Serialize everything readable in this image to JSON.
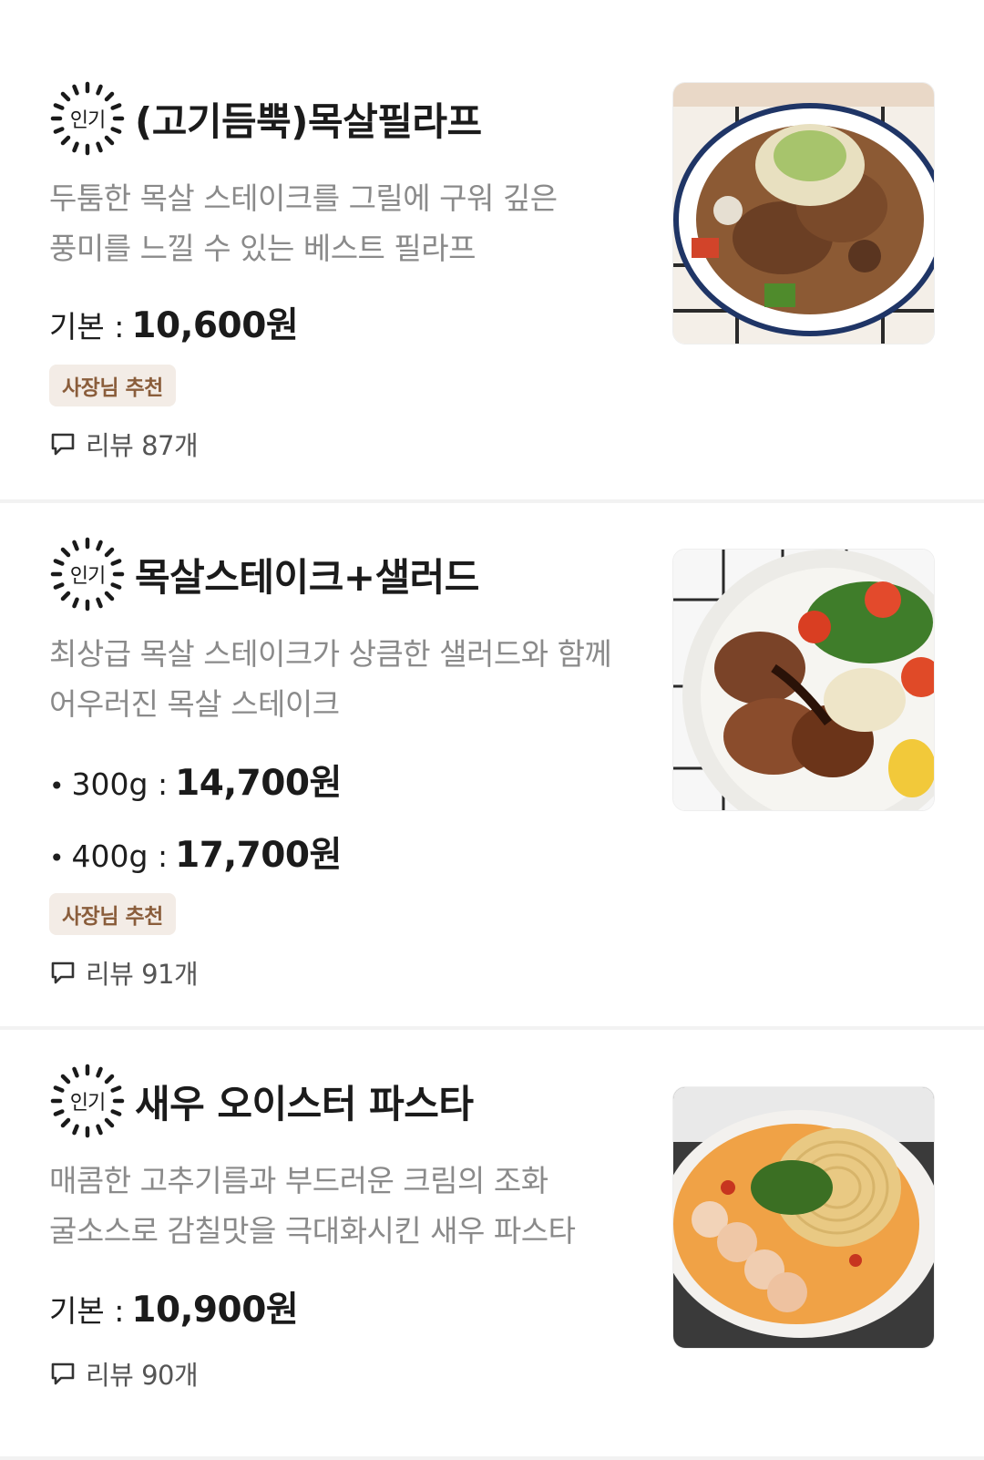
{
  "items": [
    {
      "badge": "인기",
      "title": "(고기듬뿍)목살필라프",
      "desc": [
        "두툼한 목살 스테이크를 그릴에 구워 깊은",
        "풍미를 느낄 수 있는 베스트 필라프"
      ],
      "price_label": "기본 :",
      "price_value": "10,600원",
      "tag": "사장님 추천",
      "reviews": "리뷰 87개",
      "photo_icon": "pilaf-photo"
    },
    {
      "badge": "인기",
      "title": "목살스테이크+샐러드",
      "desc": [
        "최상급 목살 스테이크가 상큼한 샐러드와 함께",
        "어우러진 목살 스테이크"
      ],
      "options": [
        {
          "bullet": "•",
          "label": "300g :",
          "value": "14,700원"
        },
        {
          "bullet": "•",
          "label": "400g :",
          "value": "17,700원"
        }
      ],
      "tag": "사장님 추천",
      "reviews": "리뷰 91개",
      "photo_icon": "steak-salad-photo"
    },
    {
      "badge": "인기",
      "title": "새우 오이스터 파스타",
      "desc": [
        "매콤한 고추기름과 부드러운 크림의 조화",
        "굴소스로 감칠맛을 극대화시킨 새우 파스타"
      ],
      "price_label": "기본 :",
      "price_value": "10,900원",
      "reviews": "리뷰 90개",
      "photo_icon": "shrimp-pasta-photo"
    }
  ],
  "colors": {
    "tag_bg": "#f3ece6",
    "tag_text": "#8a5d3b",
    "desc_text": "#8a8a8a",
    "divider": "#f2f2f2"
  }
}
